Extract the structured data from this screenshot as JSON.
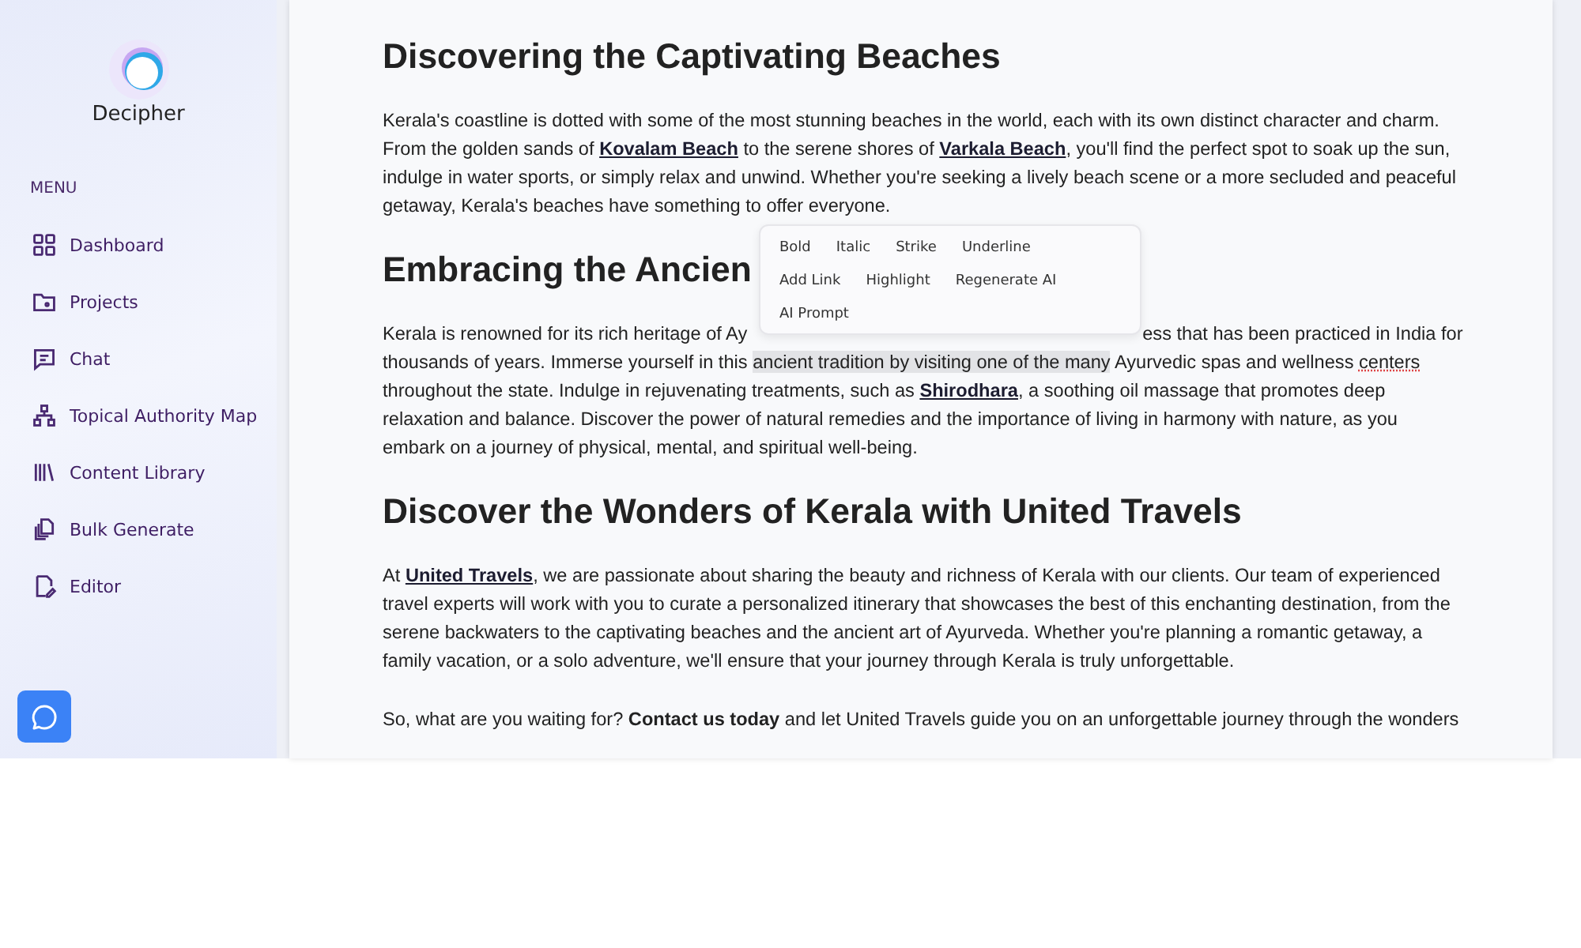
{
  "sidebar": {
    "brand": "Decipher",
    "menu_label": "MENU",
    "items": [
      {
        "label": "Dashboard"
      },
      {
        "label": "Projects"
      },
      {
        "label": "Chat"
      },
      {
        "label": "Topical Authority Map"
      },
      {
        "label": "Content Library"
      },
      {
        "label": "Bulk Generate"
      },
      {
        "label": "Editor"
      }
    ]
  },
  "document": {
    "sections": [
      {
        "heading": "Discovering the Captivating Beaches",
        "paragraphs": [
          [
            {
              "kind": "text",
              "text": "Kerala's coastline is dotted with some of the most stunning beaches in the world, each with its own distinct character and charm. From the golden sands of "
            },
            {
              "kind": "link",
              "text": "Kovalam Beach"
            },
            {
              "kind": "text",
              "text": " to the serene shores of "
            },
            {
              "kind": "link",
              "text": "Varkala Beach"
            },
            {
              "kind": "text",
              "text": ", you'll find the perfect spot to soak up the sun, indulge in water sports, or simply relax and unwind. Whether you're seeking a lively beach scene or a more secluded and peaceful getaway, Kerala's beaches have something to offer everyone."
            }
          ]
        ]
      },
      {
        "heading": "Embracing the Ancien",
        "format_menu": {
          "items": [
            "Bold",
            "Italic",
            "Strike",
            "Underline",
            "Add Link",
            "Highlight",
            "Regenerate AI",
            "AI Prompt"
          ]
        },
        "paragraphs": [
          [
            {
              "kind": "cut",
              "text": "Kerala is renowned for its rich heritage of Ay"
            },
            {
              "kind": "text",
              "text": "ess that has been practiced in India for thousands of years. Immerse yourself in this "
            },
            {
              "kind": "selected",
              "text": "ancient tradition by visiting one of the many"
            },
            {
              "kind": "text",
              "text": " Ayurvedic spas and wellness "
            },
            {
              "kind": "misspelled",
              "text": "centers"
            },
            {
              "kind": "text",
              "text": " throughout the state. Indulge in rejuvenating treatments, such as "
            },
            {
              "kind": "link",
              "text": "Shirodhara"
            },
            {
              "kind": "text",
              "text": ", a soothing oil massage that promotes deep relaxation and balance. Discover the power of natural remedies and the importance of living in harmony with nature, as you embark on a journey of physical, mental, and spiritual well-being."
            }
          ]
        ]
      },
      {
        "heading": "Discover the Wonders of Kerala with United Travels",
        "paragraphs": [
          [
            {
              "kind": "text",
              "text": "At "
            },
            {
              "kind": "link",
              "text": "United Travels"
            },
            {
              "kind": "text",
              "text": ", we are passionate about sharing the beauty and richness of Kerala with our clients. Our team of experienced travel experts will work with you to curate a personalized itinerary that showcases the best of this enchanting destination, from the serene backwaters to the captivating beaches and the ancient art of Ayurveda. Whether you're planning a romantic getaway, a family vacation, or a solo adventure, we'll ensure that your journey through Kerala is truly unforgettable."
            }
          ],
          [
            {
              "kind": "text",
              "text": "So, what are you waiting for? "
            },
            {
              "kind": "bold",
              "text": "Contact us today"
            },
            {
              "kind": "text",
              "text": " and let United Travels guide you on an unforgettable journey through the wonders"
            }
          ]
        ]
      }
    ]
  }
}
